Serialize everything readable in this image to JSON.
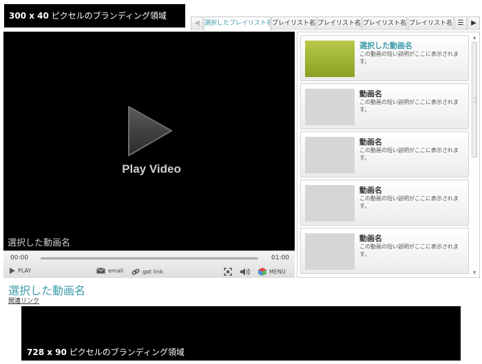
{
  "branding_top": {
    "size": "300 x 40",
    "text": "ピクセルのブランディング領域"
  },
  "tabs": {
    "items": [
      {
        "label": "選択したプレイリスト名",
        "active": true
      },
      {
        "label": "プレイリスト名",
        "active": false
      },
      {
        "label": "プレイリスト名",
        "active": false
      },
      {
        "label": "プレイリスト名",
        "active": false
      },
      {
        "label": "プレイリスト名",
        "active": false
      }
    ],
    "prev_icon": "arrow-left-icon",
    "next_icon": "arrow-right-icon",
    "list_icon": "playlist-icon"
  },
  "player": {
    "play_label": "Play Video",
    "video_title": "選択した動画名",
    "time_start": "00:00",
    "time_end": "01:00",
    "progress": 0,
    "controls": {
      "play": "PLAY",
      "email": "email",
      "get_link": "get link",
      "menu": "MENU"
    }
  },
  "playlist": {
    "items": [
      {
        "title": "選択した動画名",
        "desc": "この動画の短い説明がここに表示されます。",
        "selected": true
      },
      {
        "title": "動画名",
        "desc": "この動画の短い説明がここに表示されます。",
        "selected": false
      },
      {
        "title": "動画名",
        "desc": "この動画の短い説明がここに表示されます。",
        "selected": false
      },
      {
        "title": "動画名",
        "desc": "この動画の短い説明がここに表示されます。",
        "selected": false
      },
      {
        "title": "動画名",
        "desc": "この動画の短い説明がここに表示されます。",
        "selected": false
      }
    ]
  },
  "below": {
    "video_title": "選択した動画名",
    "related_link": "関連リンク"
  },
  "branding_bottom": {
    "size": "728 x 90",
    "text": "ピクセルのブランディング領域"
  },
  "colors": {
    "accent": "#3a9aa8",
    "selected_thumb": "#9bb132",
    "player_bg": "#000000"
  }
}
